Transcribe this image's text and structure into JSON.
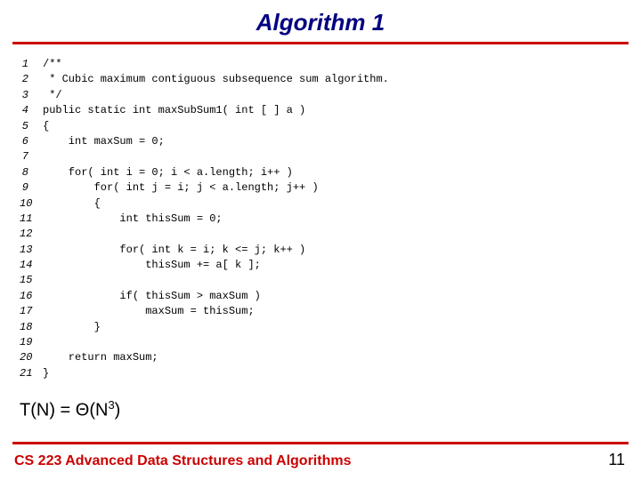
{
  "title": "Algorithm 1",
  "code_lines": [
    "/**",
    " * Cubic maximum contiguous subsequence sum algorithm.",
    " */",
    "public static int maxSubSum1( int [ ] a )",
    "{",
    "    int maxSum = 0;",
    "",
    "    for( int i = 0; i < a.length; i++ )",
    "        for( int j = i; j < a.length; j++ )",
    "        {",
    "            int thisSum = 0;",
    "",
    "            for( int k = i; k <= j; k++ )",
    "                thisSum += a[ k ];",
    "",
    "            if( thisSum > maxSum )",
    "                maxSum = thisSum;",
    "        }",
    "",
    "    return maxSum;",
    "}"
  ],
  "complexity_prefix": "T(N) = Θ(N",
  "complexity_exp": "3",
  "complexity_suffix": ")",
  "footer_left": "CS 223 Advanced Data Structures and Algorithms",
  "footer_right": "11"
}
